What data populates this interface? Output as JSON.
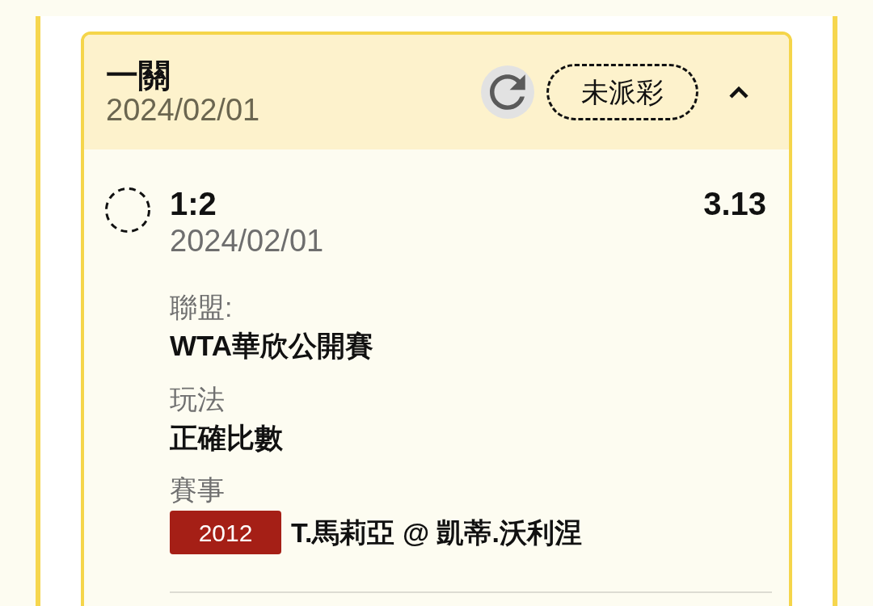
{
  "bet": {
    "title": "一關",
    "date": "2024/02/01",
    "status_label": "未派彩",
    "expanded": true,
    "legs": [
      {
        "settled": false,
        "score": "1:2",
        "date": "2024/02/01",
        "odds": "3.13",
        "fields": [
          {
            "kind": "text",
            "label": "聯盟:",
            "value": "WTA華欣公開賽"
          },
          {
            "kind": "text",
            "label": "玩法",
            "value": "正確比數"
          },
          {
            "kind": "match",
            "label": "賽事",
            "tag": "2012",
            "value": "T.馬莉亞 @ 凱蒂.沃利涅"
          }
        ]
      }
    ]
  }
}
